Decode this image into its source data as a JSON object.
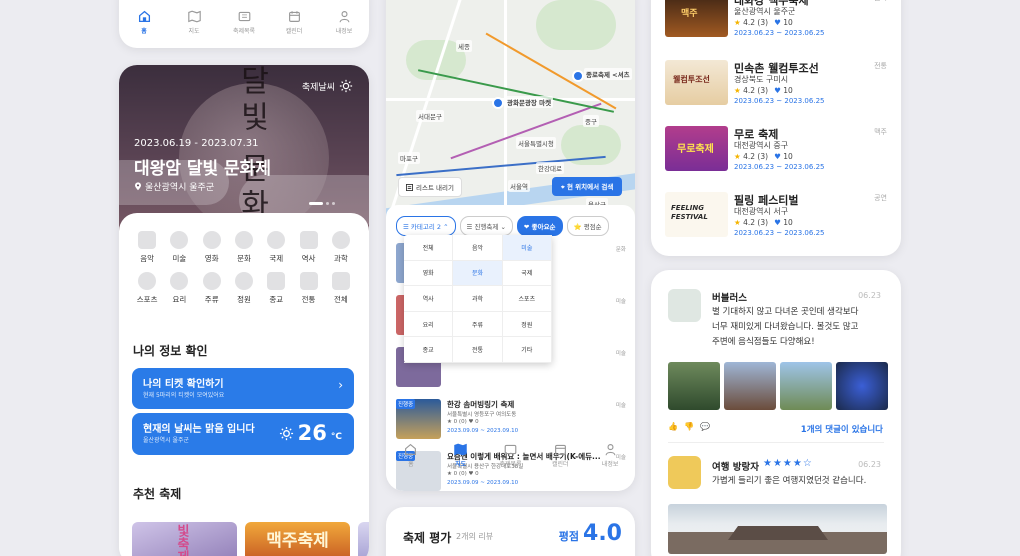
{
  "nav": [
    {
      "label": "홈",
      "icon": "home-icon",
      "active": true
    },
    {
      "label": "지도",
      "icon": "map-icon",
      "active": false
    },
    {
      "label": "축제목록",
      "icon": "ticket-icon",
      "active": false
    },
    {
      "label": "캘린더",
      "icon": "calendar-icon",
      "active": false
    },
    {
      "label": "내정보",
      "icon": "user-icon",
      "active": false
    }
  ],
  "hero": {
    "weather_label": "축제날씨",
    "calligraphy": "달빛 문화",
    "date": "2023.06.19 - 2023.07.31",
    "title": "대왕암 달빛 문화제",
    "location": "울산광역시 울주군"
  },
  "categories": [
    "음악",
    "미술",
    "영화",
    "문화",
    "국제",
    "역사",
    "과학",
    "스포츠",
    "요리",
    "주류",
    "정원",
    "종교",
    "전통",
    "전체"
  ],
  "my_info": {
    "section_title": "나의 정보 확인",
    "ticket_title": "나의 티켓 확인하기",
    "ticket_sub": "현재 5마리의 티켓이 모여있어요",
    "weather_title": "현재의 날씨는 맑음 입니다",
    "weather_sub": "울산광역시 울주군",
    "temp": "26",
    "temp_unit": "°C"
  },
  "recommend": {
    "section_title": "추천 축제",
    "thumbs": [
      "빛축제",
      "맥주축제"
    ]
  },
  "map": {
    "labels": [
      {
        "text": "종로축제 <셔츠",
        "bold": true
      },
      {
        "text": "광화문광장 마켓",
        "bold": true
      },
      {
        "text": "서울특별시청",
        "bold": false
      },
      {
        "text": "중구",
        "bold": false
      },
      {
        "text": "서울역",
        "bold": false
      },
      {
        "text": "용산구",
        "bold": false
      },
      {
        "text": "마포구",
        "bold": false
      },
      {
        "text": "서대문구",
        "bold": false
      },
      {
        "text": "세종",
        "bold": false
      },
      {
        "text": "한강대로",
        "bold": false
      }
    ],
    "list_button": "리스트 내리기",
    "search_button": "현 위치에서 검색"
  },
  "filters": {
    "chips": [
      "카테고리 2",
      "진행축제",
      "좋아요순",
      "평점순"
    ],
    "dropdown": [
      "전체",
      "음악",
      "미술",
      "영화",
      "문화",
      "국제",
      "역사",
      "과학",
      "스포츠",
      "요리",
      "주류",
      "정원",
      "종교",
      "전통",
      "기타"
    ]
  },
  "list": [
    {
      "badge": "",
      "name": "",
      "addr": "",
      "rating": "",
      "date": "",
      "cat": "문화"
    },
    {
      "badge": "",
      "name": "",
      "addr": "",
      "rating": "",
      "date": "",
      "cat": "미술"
    },
    {
      "badge": "",
      "name": "",
      "addr": "",
      "rating": "",
      "date": "",
      "cat": "미술"
    },
    {
      "badge": "진행중",
      "name": "한강 솜머빙링기 축제",
      "addr": "서울특별시 영등포구 여의도동",
      "rating": "★ 0 (0)  ♥ 0",
      "date": "2023.09.09 ~ 2023.09.10",
      "cat": "미술"
    },
    {
      "badge": "진행중",
      "name": "요즘엔 이렇게 배워요 : 놀면서 배우기(K-에듀...",
      "addr": "서울특별시 용산구 한강대로38길",
      "rating": "★ 0 (0)  ♥ 0",
      "date": "2023.09.09 ~ 2023.09.10",
      "cat": "미술"
    }
  ],
  "rating_card": {
    "title": "축제 평가",
    "count": "2개의 리뷰",
    "label": "평점",
    "score": "4.0"
  },
  "festivals": [
    {
      "name": "태화강 맥주축제",
      "addr": "울산광역시 울주군",
      "rating": "4.2 (3)",
      "hearts": "10",
      "date": "2023.06.23 ~ 2023.06.25",
      "cat": "음식"
    },
    {
      "name": "민속촌 웰컴투조선",
      "addr": "경상북도 구미시",
      "rating": "4.2 (3)",
      "hearts": "10",
      "date": "2023.06.23 ~ 2023.06.25",
      "cat": "전통"
    },
    {
      "name": "무로 축제",
      "addr": "대전광역시 중구",
      "rating": "4.2 (3)",
      "hearts": "10",
      "date": "2023.06.23 ~ 2023.06.25",
      "cat": "맥주"
    },
    {
      "name": "필링 페스티벌",
      "addr": "대전광역시 서구",
      "rating": "4.2 (3)",
      "hearts": "10",
      "date": "2023.06.23 ~ 2023.06.25",
      "cat": "공연"
    }
  ],
  "fest_thumbs": [
    "맥주",
    "웰컴투조선",
    "무로축제",
    "FEELING FESTIVAL"
  ],
  "reviews": [
    {
      "name": "버블러스",
      "date": "06.23",
      "text": [
        "별 기대하지 않고 다녀온 곳인데 생각보다",
        "너무 재미있게 다녀왔습니다. 볼것도 많고",
        "주변에 음식점들도 다양해요!"
      ],
      "comments": "1개의 댓글이 있습니다"
    },
    {
      "name": "여행 방랑자",
      "date": "06.23",
      "stars": "★★★★☆",
      "text": [
        "가볍게 들리기 좋은 여행지였던것 같습니다."
      ]
    }
  ],
  "colors": {
    "accent": "#2a74e6",
    "star": "#f5b400"
  }
}
